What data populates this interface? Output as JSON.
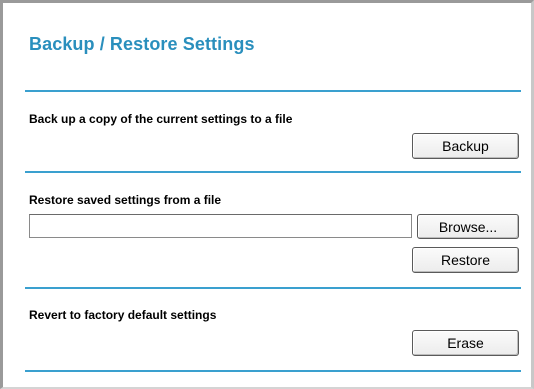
{
  "page": {
    "title": "Backup / Restore Settings"
  },
  "backup": {
    "label": "Back up a copy of the current settings to a file",
    "button": "Backup"
  },
  "restore": {
    "label": "Restore saved settings from a file",
    "file_value": "",
    "browse_button": "Browse...",
    "restore_button": "Restore"
  },
  "revert": {
    "label": "Revert to factory default settings",
    "button": "Erase"
  },
  "colors": {
    "accent": "#2a8fbd",
    "rule": "#3aa0cf"
  }
}
